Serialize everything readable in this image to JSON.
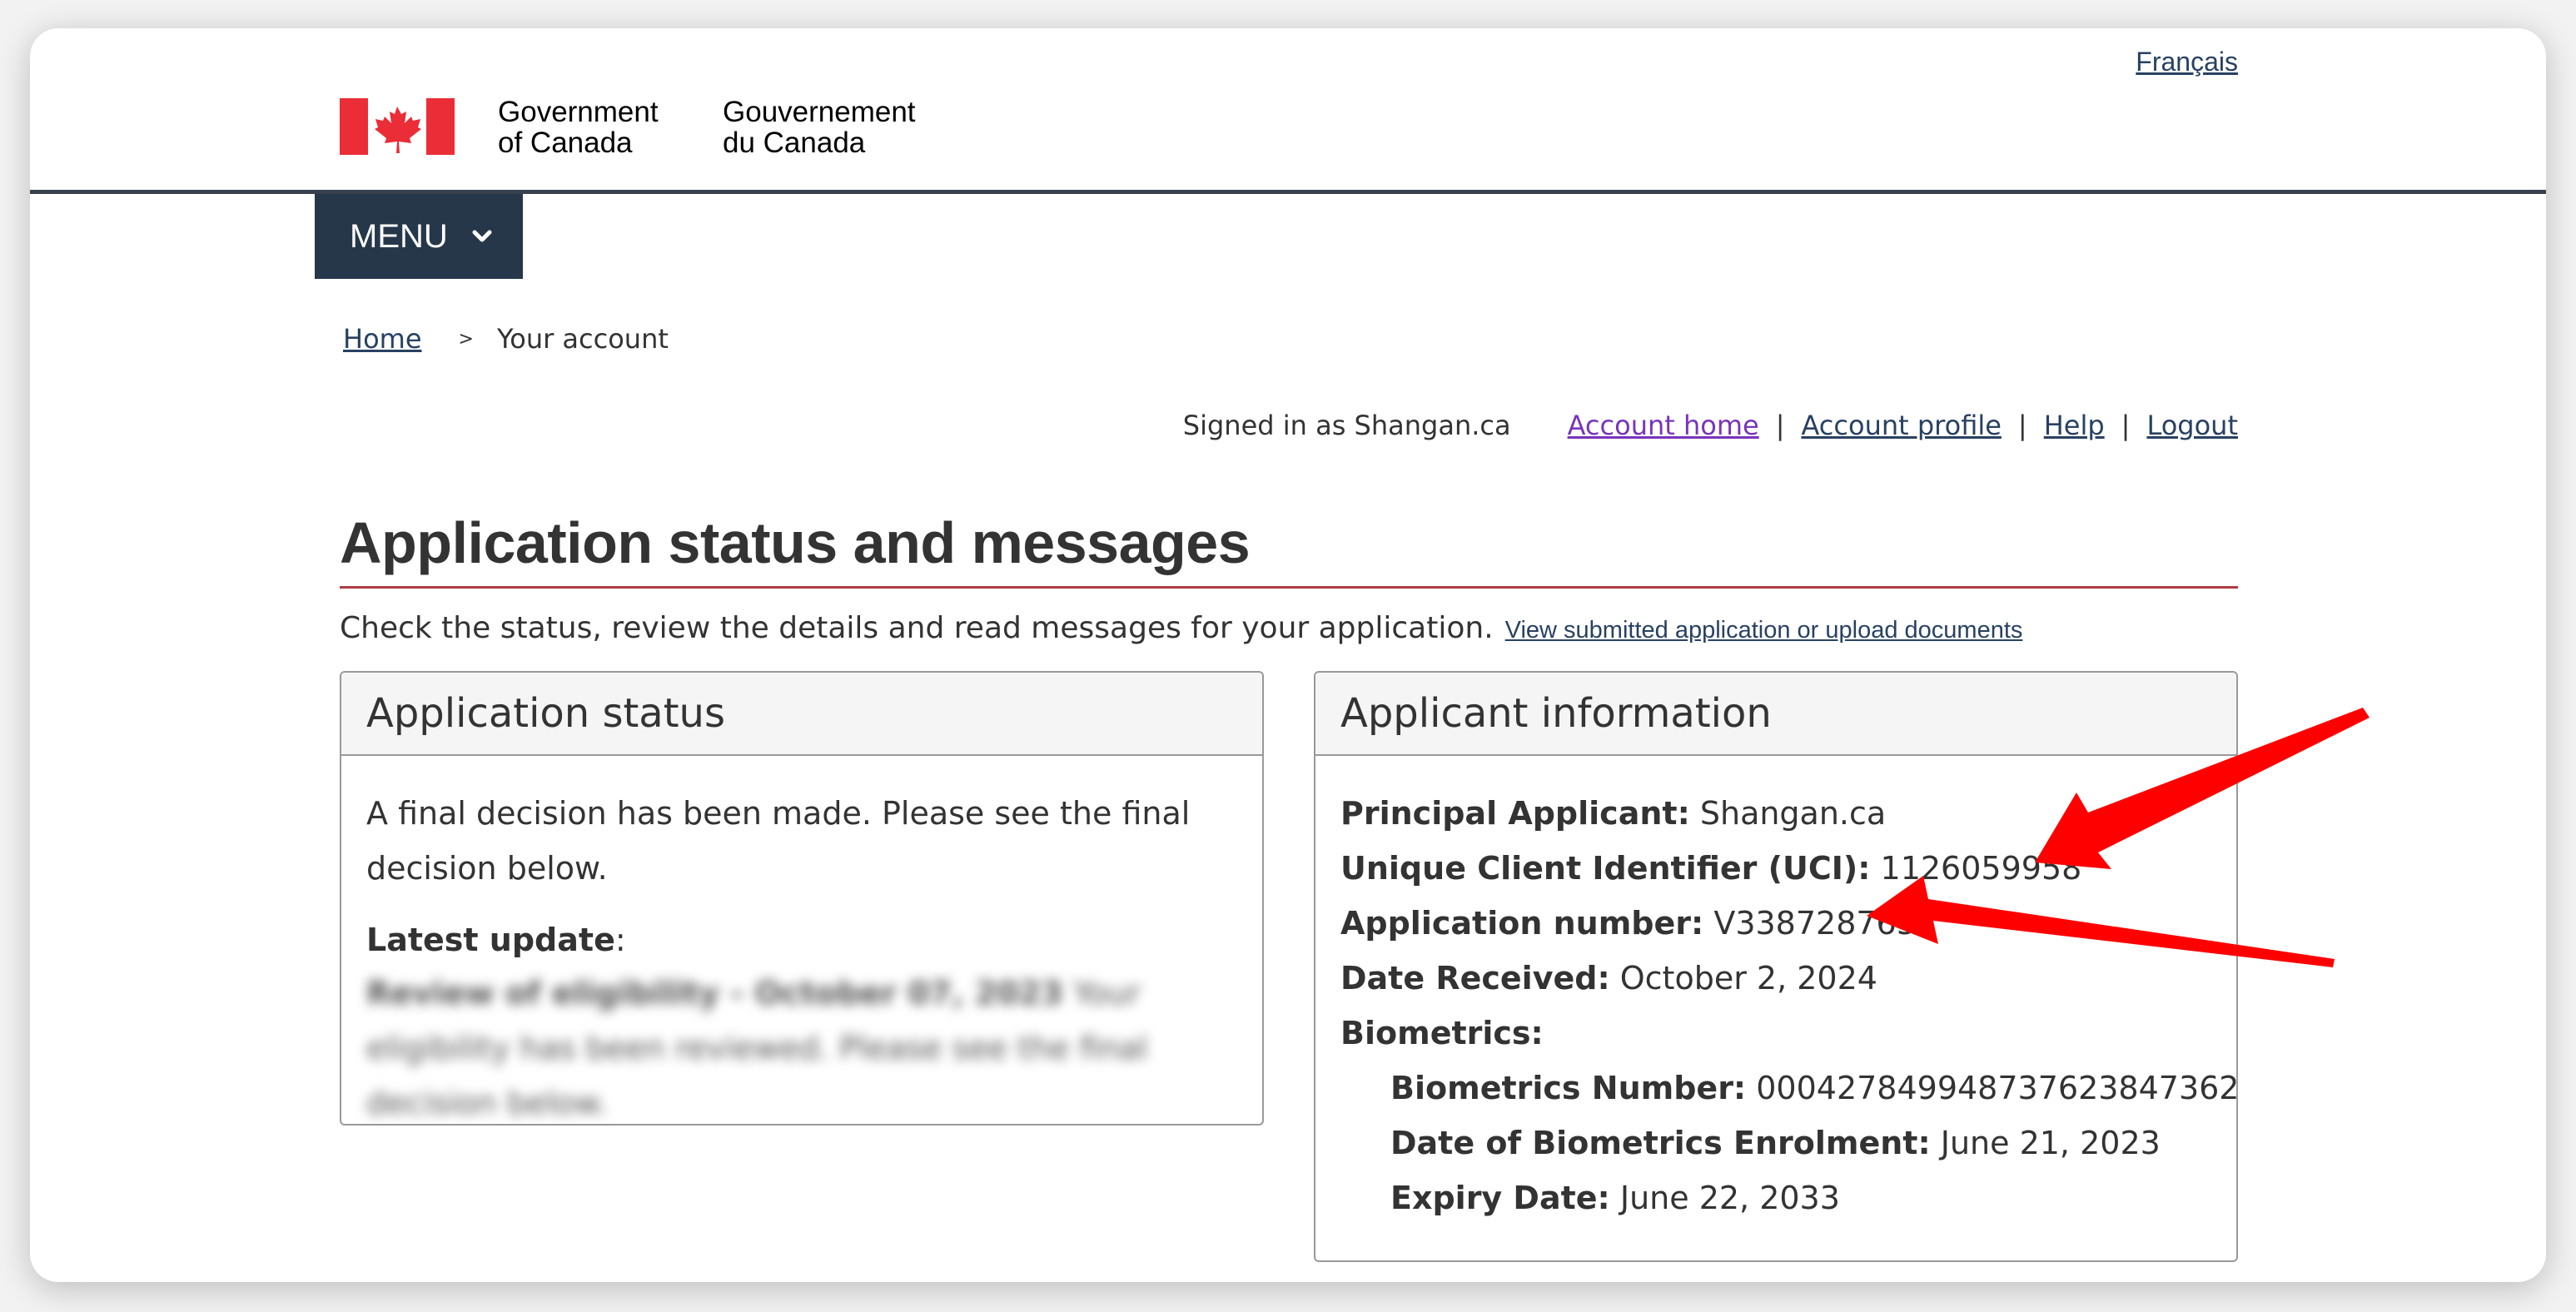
{
  "header": {
    "signature_en": "Government\nof Canada",
    "signature_fr": "Gouvernement\ndu Canada",
    "language_link": "Français"
  },
  "menu": {
    "label": "MENU"
  },
  "breadcrumb": {
    "home": "Home",
    "separator": ">",
    "current": "Your account"
  },
  "account_bar": {
    "signed_in": "Signed in as Shangan.ca",
    "links": [
      "Account home",
      "Account profile",
      "Help",
      "Logout"
    ],
    "separator": "|"
  },
  "page": {
    "title": "Application status and messages",
    "intro": "Check the status, review the details and read messages for your application.",
    "intro_link": "View submitted application or upload documents"
  },
  "application_status": {
    "heading": "Application status",
    "text": "A final decision has been made. Please see the final decision below.",
    "latest_label": "Latest update",
    "latest_colon": ":",
    "blurred_bold": "Review of eligibility - October 07, 2023",
    "blurred_text": "Your eligibility has been reviewed. Please see the final decision below."
  },
  "applicant_information": {
    "heading": "Applicant information",
    "rows": [
      {
        "label": "Principal Applicant:",
        "value": "Shangan.ca"
      },
      {
        "label": "Unique Client Identifier (UCI):",
        "value": "1126059958"
      },
      {
        "label": "Application number:",
        "value": "V338728765"
      },
      {
        "label": "Date Received:",
        "value": "October 2, 2024"
      },
      {
        "label": "Biometrics:",
        "value": ""
      }
    ],
    "biometrics": [
      {
        "label": "Biometrics Number:",
        "value": "00042784994873762384736​2"
      },
      {
        "label": "Date of Biometrics Enrolment:",
        "value": "June 21, 2023"
      },
      {
        "label": "Expiry Date:",
        "value": "June 22, 2033"
      }
    ]
  },
  "colors": {
    "flag_red": "#eb2d37",
    "menu_bg": "#26374a",
    "link": "#284162",
    "visited_link": "#7834bc",
    "title_rule": "#af3c43",
    "annotation_arrow": "#ff0000"
  },
  "icons": [
    "canada-flag-icon",
    "chevron-down-icon",
    "annotation-arrow-icon"
  ]
}
